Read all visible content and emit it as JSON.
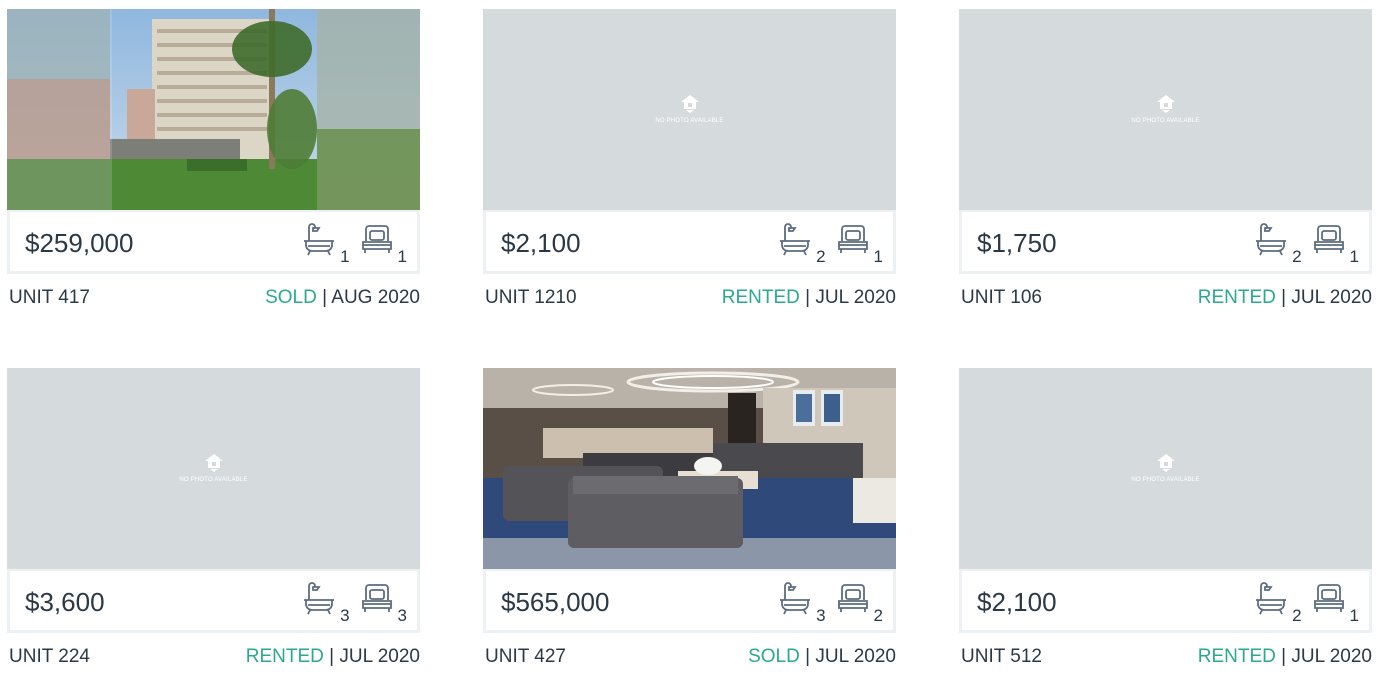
{
  "listings": [
    {
      "photo": "building-exterior",
      "price": "$259,000",
      "baths": "1",
      "beds": "1",
      "unit": "UNIT 417",
      "state": "SOLD",
      "sep": " | ",
      "date": "AUG 2020"
    },
    {
      "photo": "none",
      "price": "$2,100",
      "baths": "2",
      "beds": "1",
      "unit": "UNIT 1210",
      "state": "RENTED",
      "sep": " | ",
      "date": "JUL 2020"
    },
    {
      "photo": "none",
      "price": "$1,750",
      "baths": "2",
      "beds": "1",
      "unit": "UNIT 106",
      "state": "RENTED",
      "sep": " | ",
      "date": "JUL 2020"
    },
    {
      "photo": "none",
      "price": "$3,600",
      "baths": "3",
      "beds": "3",
      "unit": "UNIT 224",
      "state": "RENTED",
      "sep": " | ",
      "date": "JUL 2020"
    },
    {
      "photo": "lobby-interior",
      "price": "$565,000",
      "baths": "3",
      "beds": "2",
      "unit": "UNIT 427",
      "state": "SOLD",
      "sep": " | ",
      "date": "JUL 2020"
    },
    {
      "photo": "none",
      "price": "$2,100",
      "baths": "2",
      "beds": "1",
      "unit": "UNIT 512",
      "state": "RENTED",
      "sep": " | ",
      "date": "JUL 2020"
    }
  ],
  "no_photo_text": "NO PHOTO AVAILABLE",
  "colors": {
    "accent": "#2aa991",
    "text": "#2b3946",
    "placeholder": "#d5dadd",
    "border": "#eef1f3",
    "icon": "#5b6d80"
  },
  "icons": {
    "bath": "bathtub-icon",
    "bed": "bed-icon",
    "no_photo": "house-pin-icon"
  }
}
